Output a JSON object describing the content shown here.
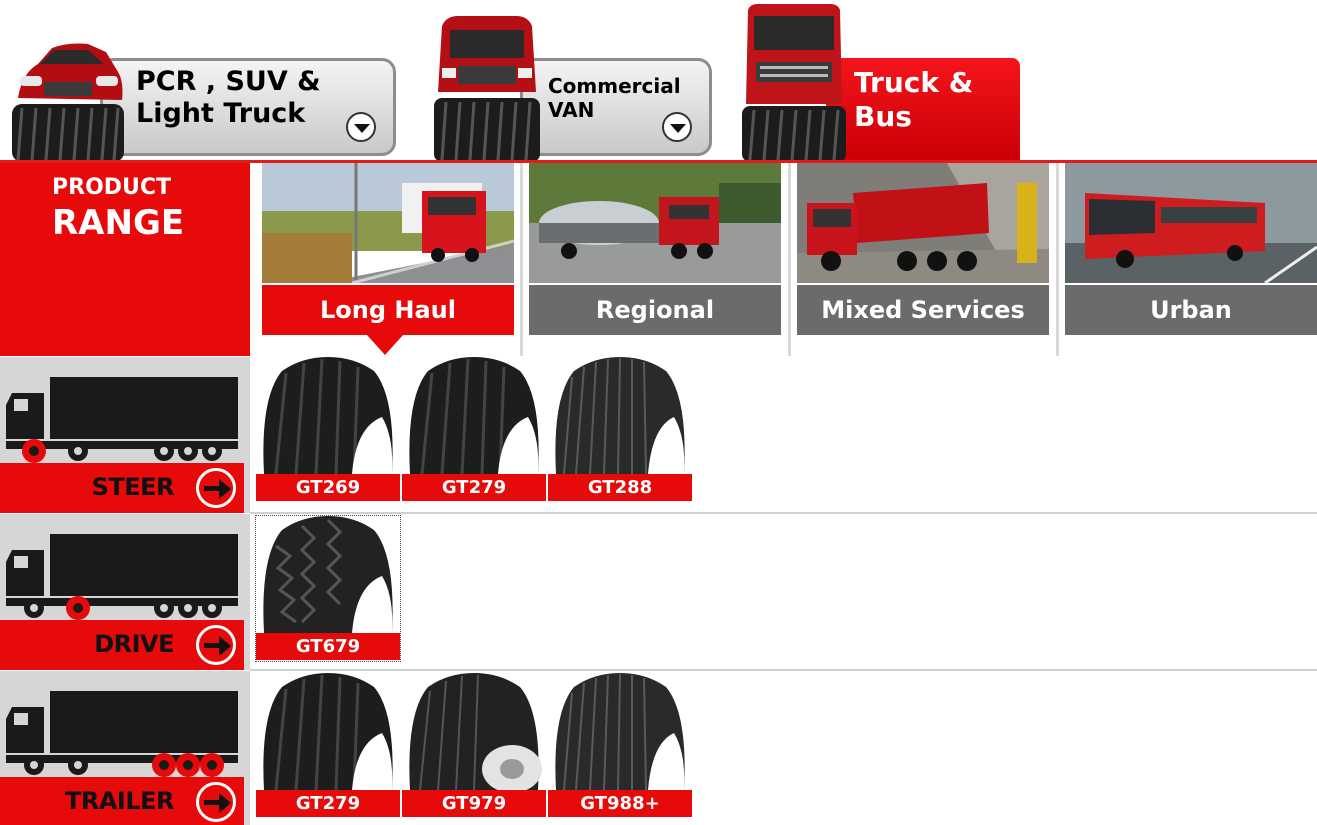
{
  "categories": [
    {
      "label": "PCR , SUV &\nLight Truck",
      "active": false
    },
    {
      "label": "Commercial\nVAN",
      "active": false
    },
    {
      "label": "Truck &\nBus",
      "active": true
    }
  ],
  "product_range": {
    "line1": "PRODUCT",
    "line2": "RANGE"
  },
  "applications": [
    {
      "label": "Long Haul",
      "active": true
    },
    {
      "label": "Regional",
      "active": false
    },
    {
      "label": "Mixed Services",
      "active": false
    },
    {
      "label": "Urban",
      "active": false
    }
  ],
  "positions": [
    {
      "label": "STEER",
      "tires": [
        "GT269",
        "GT279",
        "GT288"
      ]
    },
    {
      "label": "DRIVE",
      "tires": [
        "GT679"
      ]
    },
    {
      "label": "TRAILER",
      "tires": [
        "GT279",
        "GT979",
        "GT988+"
      ]
    }
  ],
  "colors": {
    "brand_red": "#e60a0a",
    "inactive_gray": "#6b6b6b",
    "panel_gray": "#d6d6d6"
  }
}
